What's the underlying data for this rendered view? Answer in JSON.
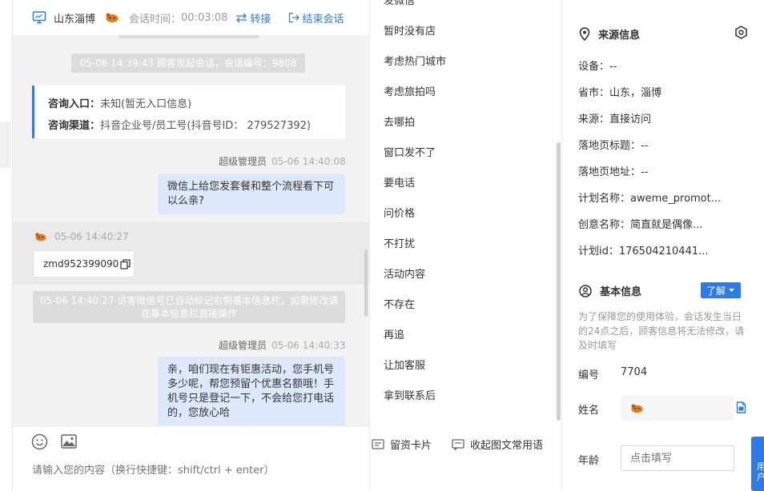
{
  "header": {
    "city": "山东淄博",
    "time_label": "会话时间：",
    "time_value": "00:03:08",
    "transfer_label": "转接",
    "end_label": "结束会话"
  },
  "messages": {
    "system_start": "05-06 14:39:43 顾客发起会话，会话编号：9808",
    "entry_label": "咨询入口：",
    "entry_value": "未知(暂无入口信息)",
    "channel_label": "咨询渠道：",
    "channel_value": "抖音企业号/员工号(抖音号ID： 279527392)",
    "agent1_name": "超级管理员",
    "agent1_time": "05-06 14:40:08",
    "agent1_text": "微信上给您发套餐和整个流程看下可以么亲?",
    "customer_time": "05-06 14:40:27",
    "customer_wechat": "zmd952399090",
    "system_note": "05-06 14:40:27 访客微信号已自动标记右侧基本信息栏，如需修改请在基本信息栏直接操作",
    "agent2_name": "超级管理员",
    "agent2_time": "05-06 14:40:33",
    "agent2_text": "亲，咱们现在有钜惠活动，您手机号多少呢，帮您预留个优惠名额哦！手机号只是登记一下，不会给您打电话的，您放心哈"
  },
  "composer": {
    "placeholder": "请输入您的内容（换行快捷键：shift/ctrl + enter）"
  },
  "phrases": {
    "partial_top": "发微信",
    "items": [
      "暂时没有店",
      "考虑热门城市",
      "考虑旅拍吗",
      "去哪拍",
      "窗口发不了",
      "要电话",
      "问价格",
      "不打扰",
      "活动内容",
      "不存在",
      "再追",
      "让加客服",
      "拿到联系后"
    ],
    "card_label": "留资卡片",
    "collapse_label": "收起图文常用语"
  },
  "source_info": {
    "title": "来源信息",
    "rows": [
      "设备：--",
      "省市：山东，淄博",
      "来源：直接访问",
      "落地页标题：--",
      "落地页地址：--",
      "计划名称：aweme_promot...",
      "创意名称：简直就是偶像...",
      "计划id：176504210441..."
    ]
  },
  "basic_info": {
    "title": "基本信息",
    "learn_label": "了解",
    "note": "为了保障您的使用体验，会话发生当日的24点之后，顾客信息将无法修改，请及时填写",
    "id_label": "编号",
    "id_value": "7704",
    "name_label": "姓名",
    "age_label": "年龄",
    "age_placeholder": "点击填写",
    "float_tab_text": "用户"
  },
  "colors": {
    "accent": "#2d7be5",
    "bubble": "#dde9fb",
    "chat_bg": "#f3f3f3",
    "system_msg": "#dcdcdc"
  }
}
